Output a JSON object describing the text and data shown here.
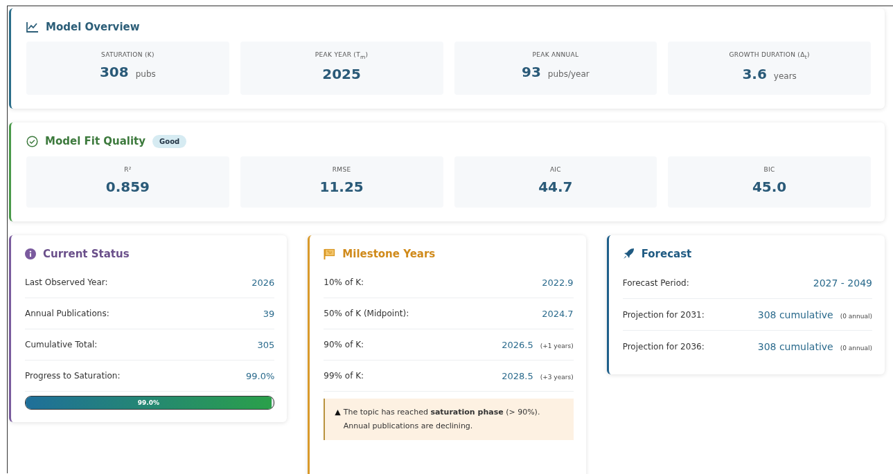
{
  "overview": {
    "title": "Model Overview",
    "metrics": [
      {
        "label": "SATURATION (K)",
        "value": "308",
        "unit": "pubs"
      },
      {
        "label": "PEAK YEAR (T$_{m}$)",
        "value": "2025"
      },
      {
        "label": "PEAK ANNUAL",
        "value": "93",
        "unit": "pubs/year"
      },
      {
        "label": "GROWTH DURATION (Δ$_{t}$)",
        "value": "3.6",
        "unit": "years"
      }
    ]
  },
  "fit": {
    "title": "Model Fit Quality",
    "badge": "Good",
    "metrics": [
      {
        "label": "R²",
        "value": "0.859"
      },
      {
        "label": "RMSE",
        "value": "11.25"
      },
      {
        "label": "AIC",
        "value": "44.7"
      },
      {
        "label": "BIC",
        "value": "45.0"
      }
    ]
  },
  "status": {
    "title": "Current Status",
    "rows": [
      {
        "label": "Last Observed Year:",
        "value": "2026"
      },
      {
        "label": "Annual Publications:",
        "value": "39"
      },
      {
        "label": "Cumulative Total:",
        "value": "305"
      },
      {
        "label": "Progress to Saturation:",
        "value": "99.0%"
      }
    ],
    "progress": {
      "level": 0.99,
      "label": "99.0%"
    }
  },
  "milestones": {
    "title": "Milestone Years",
    "rows": [
      {
        "label": "10% of K:",
        "value": "2022.9"
      },
      {
        "label": "50% of K (Midpoint):",
        "value": "2024.7"
      },
      {
        "label": "90% of K:",
        "value": "2026.5",
        "note": "(+1 years)"
      },
      {
        "label": "99% of K:",
        "value": "2028.5",
        "note": "(+3 years)"
      }
    ],
    "alert": {
      "icon": "▲",
      "text": "The topic has reached **saturation phase** (> 90%). Annual publications are declining."
    }
  },
  "forecast": {
    "title": "Forecast",
    "rows": [
      {
        "label": "Forecast Period:",
        "value": "2027 - 2049"
      },
      {
        "label": "Projection for 2031:",
        "value": "308 cumulative",
        "note": "(0 annual)"
      },
      {
        "label": "Projection for 2036:",
        "value": "308 cumulative",
        "note": "(0 annual)"
      }
    ]
  }
}
